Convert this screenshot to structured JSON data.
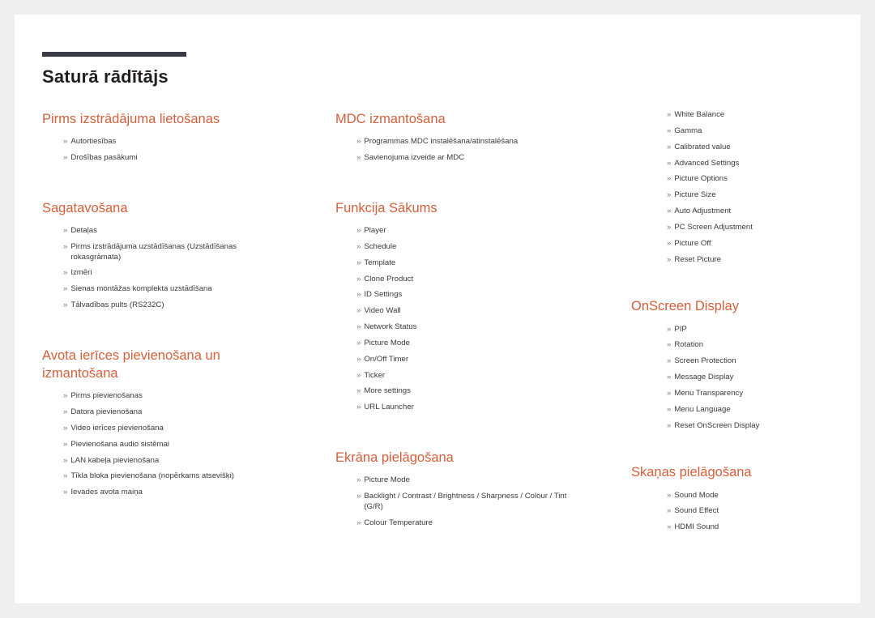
{
  "document": {
    "title": "Saturā rādītājs",
    "marker": "»",
    "accent_color": "#d2603c",
    "rule_color": "#3b3b45",
    "text_color": "#3a3a3a",
    "page_background": "#ffffff",
    "canvas_background": "#efefef"
  },
  "columns": [
    {
      "id": "column-1",
      "sections": [
        {
          "heading": "Pirms izstrādājuma lietošanas",
          "items": [
            "Autortiesības",
            "Drošības pasākumi"
          ]
        },
        {
          "heading": "Sagatavošana",
          "items": [
            "Detaļas",
            "Pirms izstrādājuma uzstādīšanas (Uzstādīšanas rokasgrāmata)",
            "Izmēri",
            "Sienas montāžas komplekta uzstādīšana",
            "Tālvadības pults (RS232C)"
          ]
        },
        {
          "heading": "Avota ierīces pievienošana un izmantošana",
          "items": [
            "Pirms pievienošanas",
            "Datora pievienošana",
            "Video ierīces pievienošana",
            "Pievienošana audio sistēmai",
            "LAN kabeļa pievienošana",
            "Tīkla bloka pievienošana (nopērkams atsevišķi)",
            "Ievades avota maiņa"
          ]
        }
      ]
    },
    {
      "id": "column-2",
      "sections": [
        {
          "heading": "MDC izmantošana",
          "items": [
            "Programmas MDC instalēšana/atinstalēšana",
            "Savienojuma izveide ar MDC"
          ]
        },
        {
          "heading": "Funkcija Sākums",
          "items": [
            "Player",
            "Schedule",
            "Template",
            "Clone Product",
            "ID Settings",
            "Video Wall",
            "Network Status",
            "Picture Mode",
            "On/Off Timer",
            "Ticker",
            "More settings",
            "URL Launcher"
          ]
        },
        {
          "heading": "Ekrāna pielāgošana",
          "items": [
            "Picture Mode",
            "Backlight / Contrast / Brightness / Sharpness / Colour / Tint (G/R)",
            "Colour Temperature"
          ]
        }
      ]
    },
    {
      "id": "column-3",
      "sections": [
        {
          "heading": "",
          "items": [
            "White Balance",
            "Gamma",
            "Calibrated value",
            "Advanced Settings",
            "Picture Options",
            "Picture Size",
            "Auto Adjustment",
            "PC Screen Adjustment",
            "Picture Off",
            "Reset Picture"
          ]
        },
        {
          "heading": "OnScreen Display",
          "items": [
            "PIP",
            "Rotation",
            "Screen Protection",
            "Message Display",
            "Menu Transparency",
            "Menu Language",
            "Reset OnScreen Display"
          ]
        },
        {
          "heading": "Skaņas pielāgošana",
          "items": [
            "Sound Mode",
            "Sound Effect",
            "HDMI Sound"
          ]
        }
      ]
    }
  ]
}
